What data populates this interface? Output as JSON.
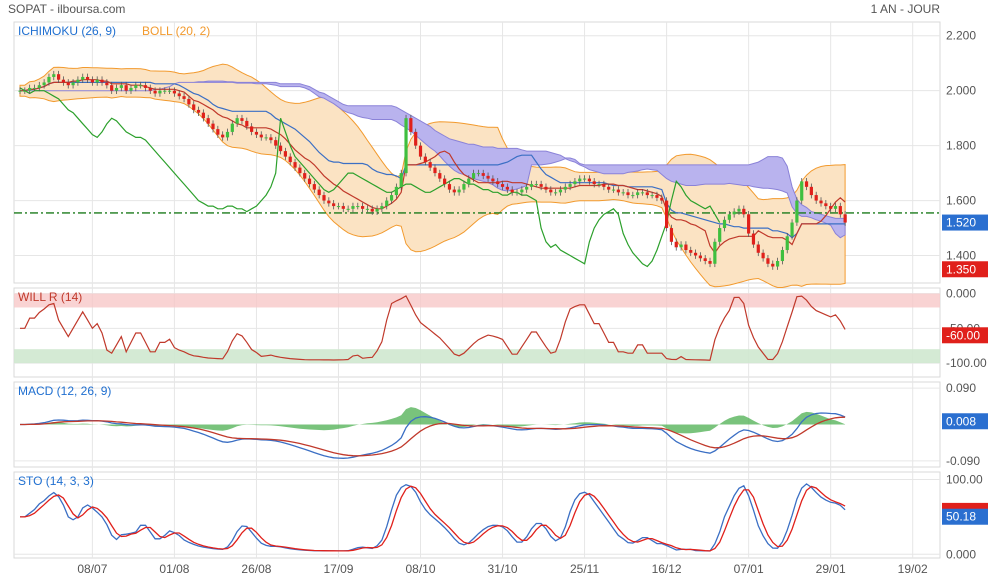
{
  "header": {
    "title": "SOPAT - ilboursa.com",
    "period": "1 AN - JOUR"
  },
  "colors": {
    "green": "#2ca02c",
    "red": "#e0201b",
    "blue": "#3b6fc4",
    "orange": "#f29a2e",
    "cloud": "#b9b3ee",
    "boll_fill": "#fbe3c3",
    "axis_text": "#555555",
    "grid": "#e6e6e6",
    "label_blue": "#1f6fd0",
    "macd_hist": "#4caf50"
  },
  "chart_data": [
    {
      "id": "price",
      "type": "candlestick",
      "legend": [
        "ICHIMOKU (26, 9)",
        "BOLL (20, 2)"
      ],
      "ylim": [
        1.3,
        2.25
      ],
      "y_ticks": [
        "2.200",
        "2.000",
        "1.800",
        "1.600",
        "1.400"
      ],
      "y_tick_values": [
        2.2,
        2.0,
        1.8,
        1.6,
        1.4
      ],
      "last_value": "1.520",
      "last_value_num": 1.52,
      "min_value": "1.350",
      "min_value_num": 1.35,
      "reference_level": 1.555,
      "close": [
        2.0,
        2.0,
        2.01,
        2.01,
        2.02,
        2.03,
        2.05,
        2.06,
        2.04,
        2.03,
        2.02,
        2.03,
        2.04,
        2.05,
        2.04,
        2.03,
        2.04,
        2.03,
        2.02,
        2.0,
        2.01,
        2.02,
        2.0,
        2.01,
        2.02,
        2.02,
        2.01,
        2.0,
        1.99,
        2.0,
        2.0,
        2.0,
        1.99,
        1.98,
        1.97,
        1.95,
        1.93,
        1.92,
        1.9,
        1.88,
        1.86,
        1.84,
        1.83,
        1.85,
        1.88,
        1.9,
        1.89,
        1.87,
        1.85,
        1.84,
        1.83,
        1.83,
        1.82,
        1.8,
        1.78,
        1.76,
        1.74,
        1.72,
        1.7,
        1.68,
        1.66,
        1.64,
        1.62,
        1.6,
        1.59,
        1.58,
        1.58,
        1.57,
        1.57,
        1.58,
        1.58,
        1.57,
        1.57,
        1.56,
        1.57,
        1.58,
        1.6,
        1.62,
        1.65,
        1.7,
        1.9,
        1.85,
        1.8,
        1.76,
        1.74,
        1.72,
        1.7,
        1.68,
        1.66,
        1.64,
        1.63,
        1.64,
        1.66,
        1.68,
        1.7,
        1.7,
        1.69,
        1.68,
        1.67,
        1.66,
        1.65,
        1.64,
        1.63,
        1.63,
        1.64,
        1.65,
        1.66,
        1.66,
        1.65,
        1.64,
        1.63,
        1.63,
        1.64,
        1.65,
        1.66,
        1.67,
        1.68,
        1.68,
        1.67,
        1.66,
        1.66,
        1.65,
        1.64,
        1.64,
        1.63,
        1.63,
        1.62,
        1.62,
        1.63,
        1.63,
        1.62,
        1.62,
        1.61,
        1.6,
        1.5,
        1.45,
        1.43,
        1.44,
        1.42,
        1.41,
        1.4,
        1.39,
        1.38,
        1.37,
        1.45,
        1.5,
        1.53,
        1.55,
        1.56,
        1.57,
        1.55,
        1.48,
        1.44,
        1.41,
        1.39,
        1.37,
        1.36,
        1.38,
        1.42,
        1.47,
        1.52,
        1.6,
        1.67,
        1.65,
        1.62,
        1.6,
        1.59,
        1.58,
        1.57,
        1.58,
        1.55,
        1.52
      ]
    },
    {
      "id": "willr",
      "type": "line",
      "legend": [
        "WILL R (14)"
      ],
      "ylim": [
        -120,
        8
      ],
      "y_ticks": [
        "0.000",
        "-50.00",
        "-100.00"
      ],
      "y_tick_values": [
        0,
        -50,
        -100
      ],
      "last_value": "-60.00",
      "last_value_num": -60,
      "overbought": -20,
      "oversold": -80
    },
    {
      "id": "macd",
      "type": "line",
      "legend": [
        "MACD (12, 26, 9)"
      ],
      "ylim": [
        -0.105,
        0.105
      ],
      "y_ticks": [
        "0.090",
        "-0.090"
      ],
      "y_tick_values": [
        0.09,
        -0.09
      ],
      "last_value": "0.008",
      "last_value_num": 0.008
    },
    {
      "id": "sto",
      "type": "line",
      "legend": [
        "STO (14, 3, 3)"
      ],
      "ylim": [
        -5,
        110
      ],
      "y_ticks": [
        "100.00",
        "0.000"
      ],
      "y_tick_values": [
        100,
        0
      ],
      "last_value": "50.18",
      "last_value_num": 50.18,
      "hidden_value": "58.00",
      "hidden_value_num": 58
    }
  ],
  "x_axis": {
    "labels": [
      "08/07",
      "01/08",
      "26/08",
      "17/09",
      "08/10",
      "31/10",
      "25/11",
      "16/12",
      "07/01",
      "29/01",
      "19/02"
    ],
    "label_index": [
      15,
      32,
      49,
      66,
      83,
      100,
      117,
      134,
      151,
      168,
      185
    ]
  }
}
